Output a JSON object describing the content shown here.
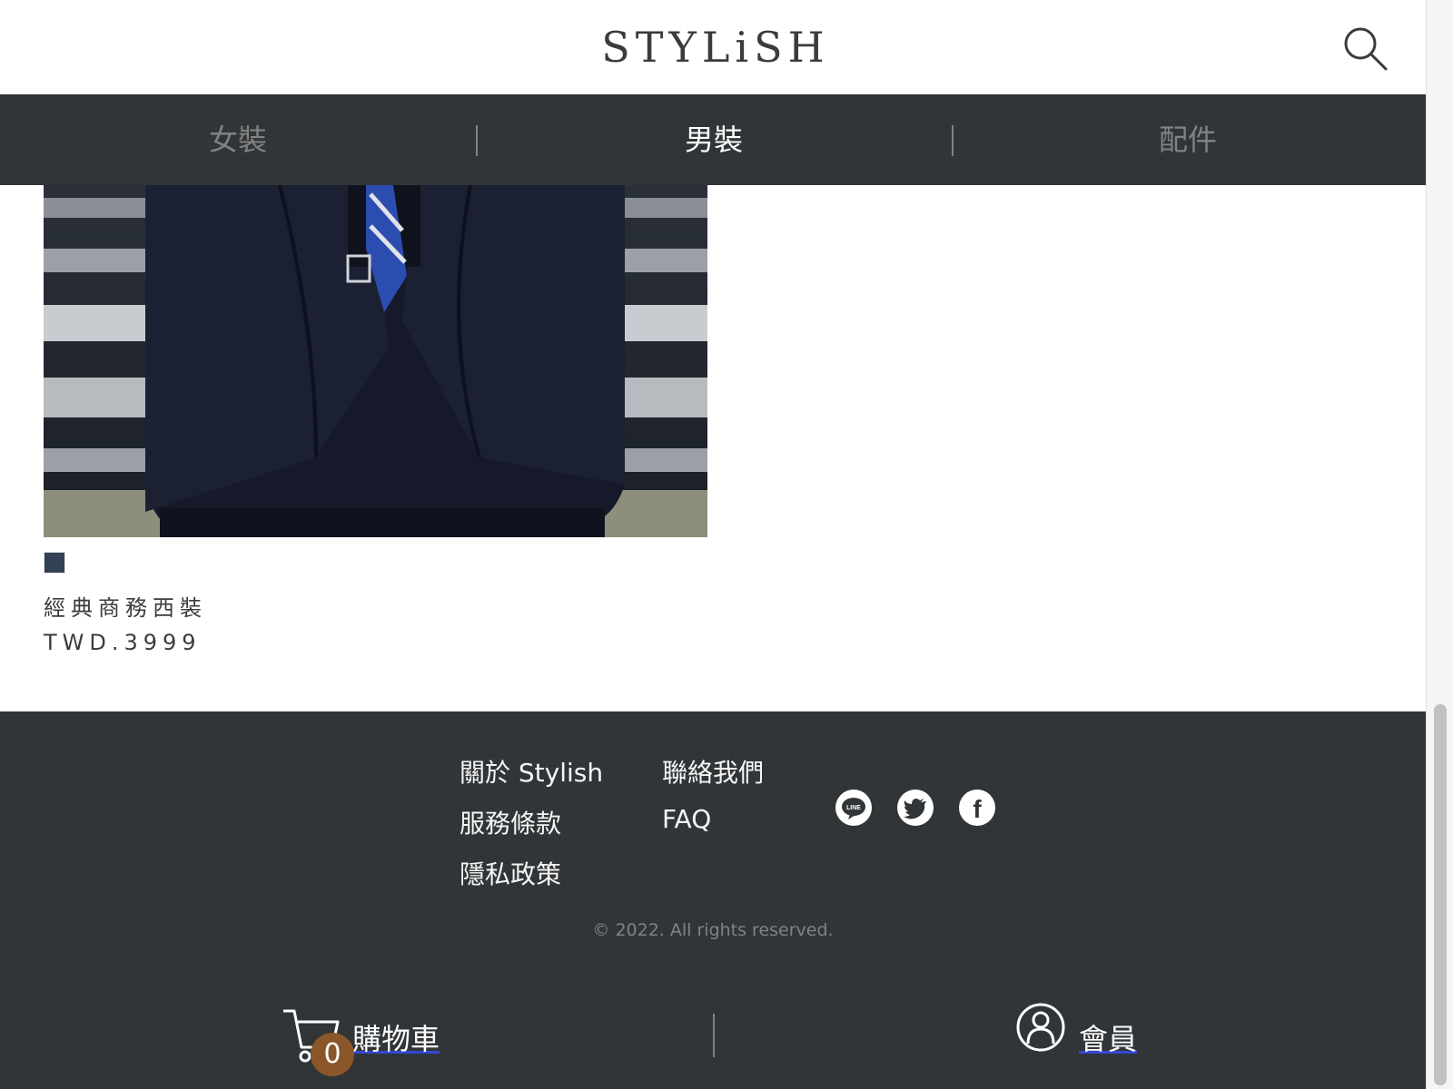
{
  "header": {
    "logo": "STYLiSH",
    "search_icon": "search-icon"
  },
  "categories": [
    {
      "label": "女裝",
      "active": false
    },
    {
      "label": "男裝",
      "active": true
    },
    {
      "label": "配件",
      "active": false
    }
  ],
  "product": {
    "name": "經典商務西裝",
    "price": "TWD.3999",
    "colors": [
      "#334155"
    ]
  },
  "footer": {
    "links": [
      "關於 Stylish",
      "服務條款",
      "隱私政策",
      "聯絡我們",
      "FAQ"
    ],
    "social": [
      {
        "icon": "line-icon",
        "text": "LINE"
      },
      {
        "icon": "twitter-icon"
      },
      {
        "icon": "facebook-icon",
        "text": "f"
      }
    ],
    "copyright": "© 2022. All rights reserved."
  },
  "bottom_bar": {
    "cart_label": "購物車",
    "cart_count": "0",
    "member_label": "會員"
  },
  "colors": {
    "nav_bg": "#313538",
    "text_dark": "#3f3a3a",
    "muted": "#828282",
    "badge": "#8b572a"
  }
}
